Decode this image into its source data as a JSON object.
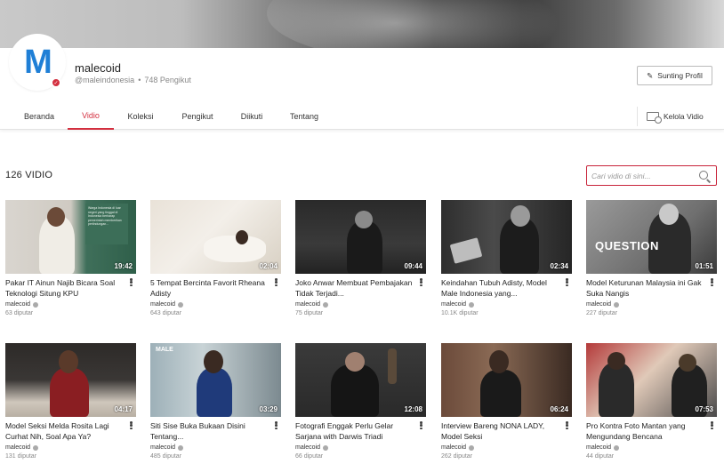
{
  "channel": {
    "name": "malecoid",
    "handle": "@maleindonesia",
    "followers": "748 Pengikut",
    "logo_letter": "M",
    "edit_label": "Sunting Profil"
  },
  "tabs": [
    {
      "label": "Beranda"
    },
    {
      "label": "Vidio"
    },
    {
      "label": "Koleksi"
    },
    {
      "label": "Pengikut"
    },
    {
      "label": "Diikuti"
    },
    {
      "label": "Tentang"
    }
  ],
  "manage_label": "Kelola Vidio",
  "video_count": "126 VIDIO",
  "search": {
    "placeholder": "Cari vidio di sini..."
  },
  "videos": [
    {
      "title": "Pakar IT Ainun Najib Bicara Soal Teknologi Situng KPU",
      "duration": "19:42",
      "owner": "malecoid",
      "views": "63 diputar",
      "overlay": "Warga Indonesia di luar negeri yang tinggal di Indonesia berharap pemerintah memberikan perlindungan..."
    },
    {
      "title": "5 Tempat Bercinta Favorit Rheana Adisty",
      "duration": "02:04",
      "owner": "malecoid",
      "views": "643 diputar"
    },
    {
      "title": "Joko Anwar Membuat Pembajakan Tidak Terjadi...",
      "duration": "09:44",
      "owner": "malecoid",
      "views": "75 diputar"
    },
    {
      "title": "Keindahan Tubuh Adisty, Model Male Indonesia yang...",
      "duration": "02:34",
      "owner": "malecoid",
      "views": "10.1K diputar"
    },
    {
      "title": "Model Keturunan Malaysia ini Gak Suka Nangis",
      "duration": "01:51",
      "owner": "malecoid",
      "views": "227 diputar",
      "overlay": "QUESTION"
    },
    {
      "title": "Model Seksi Melda Rosita Lagi Curhat Nih, Soal Apa Ya?",
      "duration": "04:17",
      "owner": "malecoid",
      "views": "131 diputar"
    },
    {
      "title": "Siti Sise Buka Bukaan Disini Tentang...",
      "duration": "03:29",
      "owner": "malecoid",
      "views": "485 diputar",
      "overlay": "MALE"
    },
    {
      "title": "Fotografi Enggak Perlu Gelar Sarjana with Darwis Triadi",
      "duration": "12:08",
      "owner": "malecoid",
      "views": "66 diputar"
    },
    {
      "title": "Interview Bareng NONA LADY, Model Seksi",
      "duration": "06:24",
      "owner": "malecoid",
      "views": "262 diputar"
    },
    {
      "title": "Pro Kontra Foto Mantan yang Mengundang Bencana",
      "duration": "07:53",
      "owner": "malecoid",
      "views": "44 diputar"
    }
  ],
  "colors": {
    "accent": "#d32f3f",
    "logo": "#1f7fd6"
  }
}
